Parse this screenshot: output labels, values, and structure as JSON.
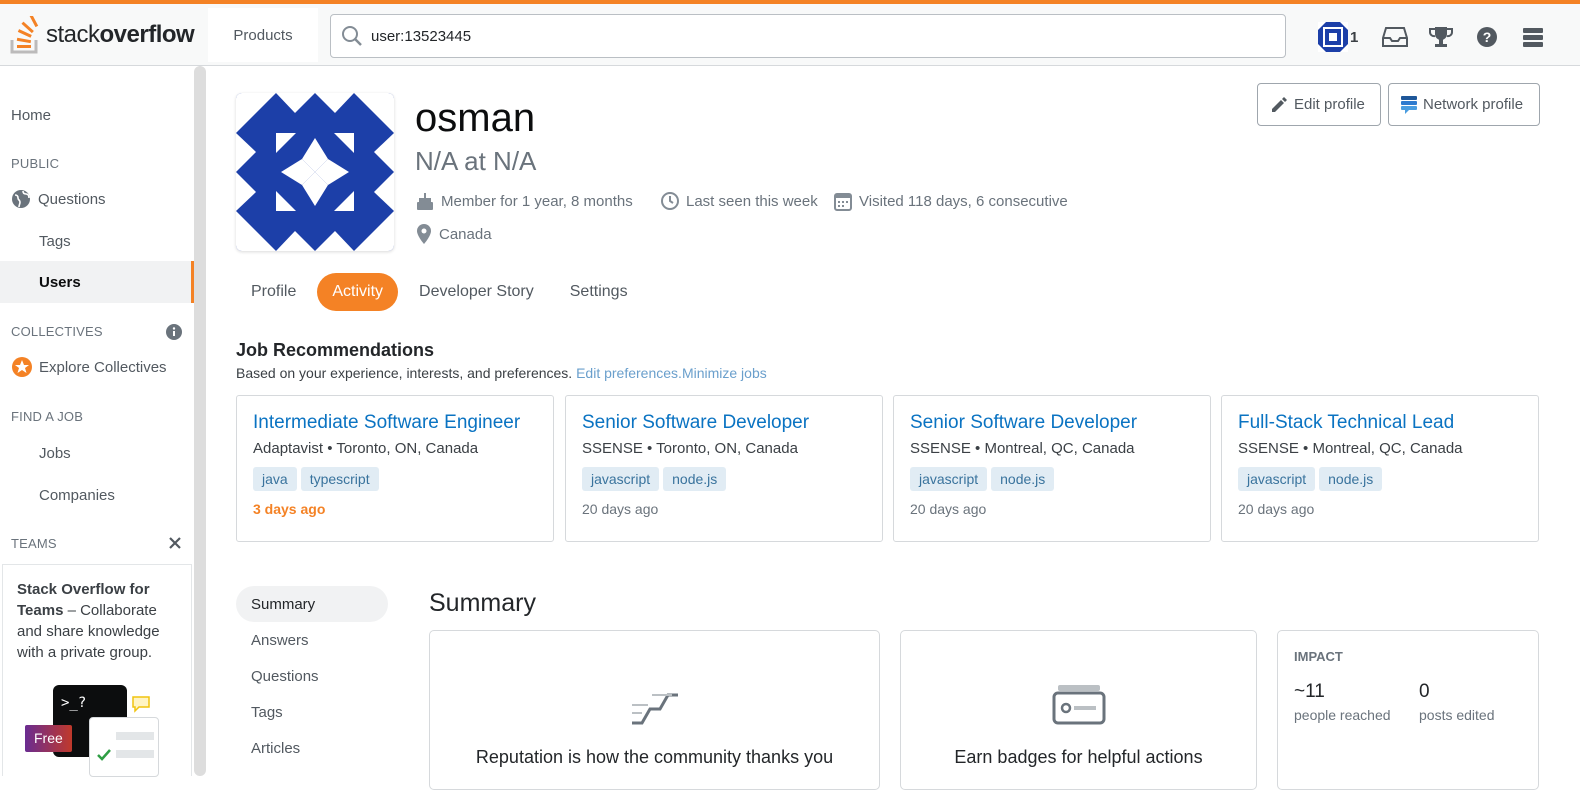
{
  "topbar": {
    "logo_light": "stack",
    "logo_bold": "overflow",
    "products_label": "Products",
    "search_value": "user:13523445",
    "reputation": "1"
  },
  "nav": {
    "home": "Home",
    "public_section": "PUBLIC",
    "questions": "Questions",
    "tags": "Tags",
    "users": "Users",
    "collectives_section": "COLLECTIVES",
    "explore_collectives": "Explore Collectives",
    "find_job_section": "FIND A JOB",
    "jobs": "Jobs",
    "companies": "Companies",
    "teams_section": "TEAMS",
    "teams_promo_bold": "Stack Overflow for Teams",
    "teams_promo_rest": " – Collaborate and share knowledge with a private group.",
    "free_badge": "Free",
    "prompt_text": ">_?"
  },
  "profile": {
    "name": "osman",
    "title": "N/A at N/A",
    "member_for": "Member for 1 year, 8 months",
    "last_seen": "Last seen this week",
    "visited": "Visited 118 days, 6 consecutive",
    "location": "Canada",
    "edit_profile": "Edit profile",
    "network_profile": "Network profile"
  },
  "tabs": [
    "Profile",
    "Activity",
    "Developer Story",
    "Settings"
  ],
  "jobs": {
    "title": "Job Recommendations",
    "subtitle": "Based on your experience, interests, and preferences.",
    "edit_prefs": "Edit preferences.",
    "minimize": "Minimize jobs",
    "cards": [
      {
        "title": "Intermediate Software Engineer",
        "company": "Adaptavist • Toronto, ON, Canada",
        "tags": [
          "java",
          "typescript"
        ],
        "time": "3 days ago"
      },
      {
        "title": "Senior Software Developer",
        "company": "SSENSE • Toronto, ON, Canada",
        "tags": [
          "javascript",
          "node.js"
        ],
        "time": "20 days ago"
      },
      {
        "title": "Senior Software Developer",
        "company": "SSENSE • Montreal, QC, Canada",
        "tags": [
          "javascript",
          "node.js"
        ],
        "time": "20 days ago"
      },
      {
        "title": "Full-Stack Technical Lead",
        "company": "SSENSE • Montreal, QC, Canada",
        "tags": [
          "javascript",
          "node.js"
        ],
        "time": "20 days ago"
      }
    ]
  },
  "sub_nav": [
    "Summary",
    "Answers",
    "Questions",
    "Tags",
    "Articles"
  ],
  "summary": {
    "title": "Summary",
    "reputation_text": "Reputation is how the community thanks you",
    "badges_text": "Earn badges for helpful actions",
    "impact_label": "IMPACT",
    "people_reached_value": "~11",
    "people_reached_label": "people reached",
    "posts_edited_value": "0",
    "posts_edited_label": "posts edited"
  },
  "colors": {
    "accent": "#f48225",
    "link": "#0a73c2",
    "avatar_blue": "#1c3fa8"
  }
}
